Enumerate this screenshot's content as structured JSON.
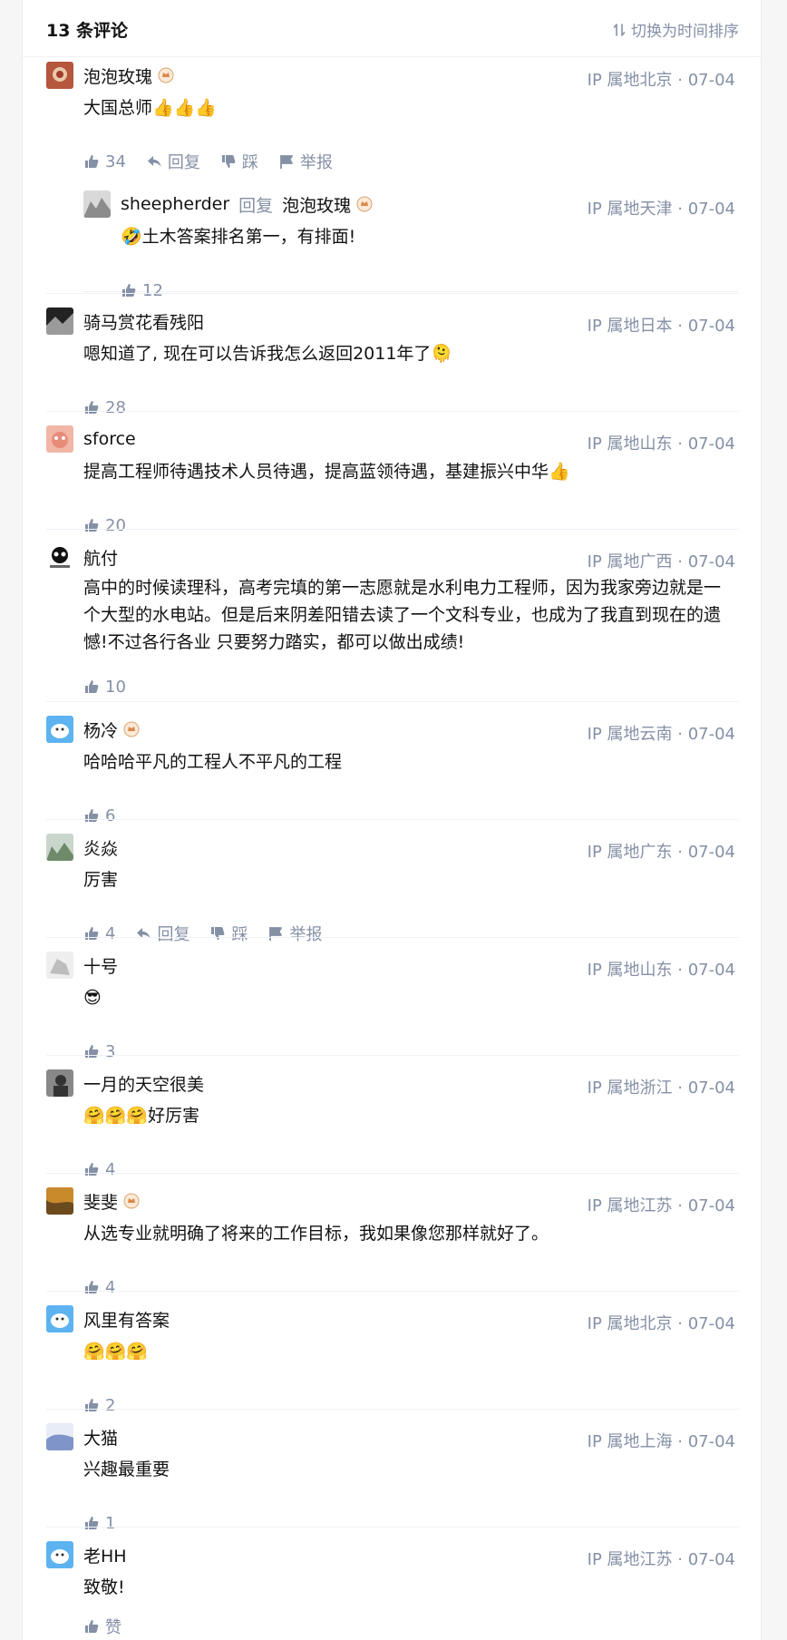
{
  "header": {
    "title": "13 条评论",
    "sort_label": "切换为时间排序"
  },
  "labels": {
    "reply": "回复",
    "dislike": "踩",
    "report": "举报",
    "reply_to": "回复"
  },
  "comments": [
    {
      "author": "泡泡玫瑰",
      "has_badge": true,
      "meta": "IP 属地北京 · 07-04",
      "content": "大国总师👍👍👍",
      "likes": "34",
      "avatar_colors": [
        "#b5563d",
        "#e8c9a8"
      ],
      "show_extra_actions": true
    },
    {
      "author": "sheepherder",
      "reply_to": "泡泡玫瑰",
      "reply_to_badge": true,
      "meta": "IP 属地天津 · 07-04",
      "content": "🤣土木答案排名第一，有排面!",
      "likes": "12",
      "avatar_colors": [
        "#d9d9d9",
        "#8c8c8c"
      ]
    },
    {
      "author": "骑马赏花看残阳",
      "meta": "IP 属地日本 · 07-04",
      "content": "嗯知道了, 现在可以告诉我怎么返回2011年了🫠",
      "likes": "28",
      "avatar_colors": [
        "#222222",
        "#9a9a9a"
      ]
    },
    {
      "author": "sforce",
      "meta": "IP 属地山东 · 07-04",
      "content": "提高工程师待遇技术人员待遇，提高蓝领待遇，基建振兴中华👍",
      "likes": "20",
      "avatar_colors": [
        "#f2b6a6",
        "#e88c7a"
      ]
    },
    {
      "author": "航付",
      "meta": "IP 属地广西 · 07-04",
      "content": "高中的时候读理科，高考完填的第一志愿就是水利电力工程师，因为我家旁边就是一个大型的水电站。但是后来阴差阳错去读了一个文科专业，也成为了我直到现在的遗憾!不过各行各业 只要努力踏实，都可以做出成绩!",
      "likes": "10",
      "avatar_colors": [
        "#ffffff",
        "#111111"
      ]
    },
    {
      "author": "杨冷",
      "has_badge": true,
      "meta": "IP 属地云南 · 07-04",
      "content": "哈哈哈平凡的工程人不平凡的工程",
      "likes": "6",
      "avatar_colors": [
        "#5cb3f0",
        "#ffffff"
      ]
    },
    {
      "author": "炎焱",
      "meta": "IP 属地广东 · 07-04",
      "content": "厉害",
      "likes": "4",
      "avatar_colors": [
        "#6f8a6a",
        "#c9d6cc"
      ],
      "show_extra_actions": true
    },
    {
      "author": "十号",
      "meta": "IP 属地山东 · 07-04",
      "content": "😎",
      "likes": "3",
      "avatar_colors": [
        "#eeeeee",
        "#bdbdbd"
      ]
    },
    {
      "author": "一月的天空很美",
      "meta": "IP 属地浙江 · 07-04",
      "content": "🤗🤗🤗好厉害",
      "likes": "4",
      "avatar_colors": [
        "#333333",
        "#888888"
      ]
    },
    {
      "author": "斐斐",
      "has_badge": true,
      "meta": "IP 属地江苏 · 07-04",
      "content": "从选专业就明确了将来的工作目标，我如果像您那样就好了。",
      "likes": "4",
      "avatar_colors": [
        "#c98a2c",
        "#6b4a1e"
      ]
    },
    {
      "author": "风里有答案",
      "meta": "IP 属地北京 · 07-04",
      "content": "🤗🤗🤗",
      "likes": "2",
      "avatar_colors": [
        "#5cb3f0",
        "#ffffff"
      ]
    },
    {
      "author": "大猫",
      "meta": "IP 属地上海 · 07-04",
      "content": "兴趣最重要",
      "likes": "1",
      "avatar_colors": [
        "#7f95c9",
        "#e7ecf7"
      ]
    },
    {
      "author": "老HH",
      "meta": "IP 属地江苏 · 07-04",
      "content": "致敬!",
      "likes": "赞",
      "avatar_colors": [
        "#5cb3f0",
        "#ffffff"
      ]
    }
  ]
}
